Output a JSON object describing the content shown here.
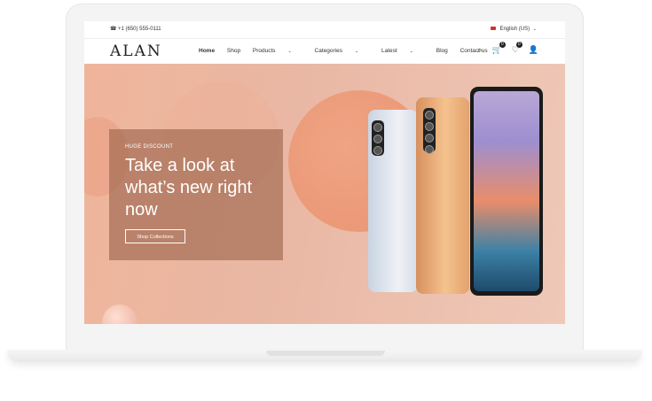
{
  "topbar": {
    "phone": "+1 (650) 555-0111",
    "language": "English (US)"
  },
  "header": {
    "logo": "ALAN",
    "nav": [
      "Home",
      "Shop",
      "Products",
      "Categories",
      "Latest",
      "Blog",
      "Contact us"
    ],
    "cart_count": "0",
    "wishlist_count": "0"
  },
  "hero": {
    "tag": "HUGE DISCOUNT",
    "title": "Take a look at what’s new right now",
    "button": "Shop Collections"
  }
}
